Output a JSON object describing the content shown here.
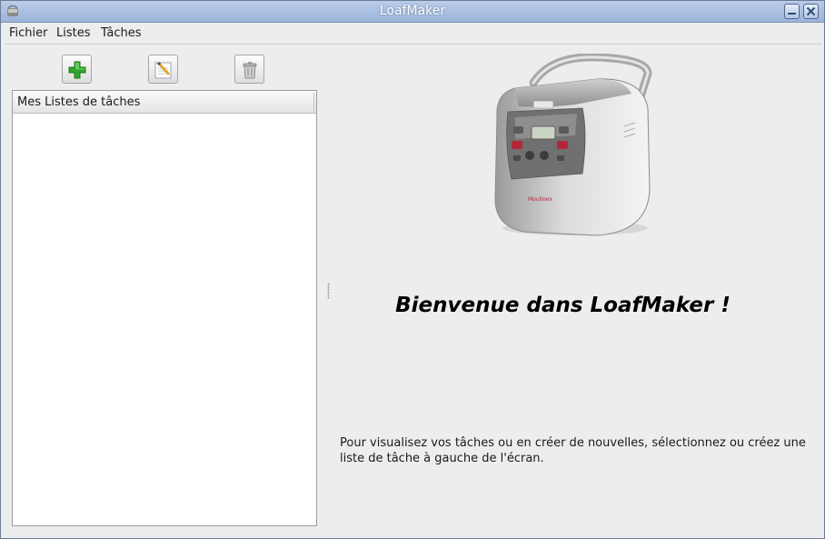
{
  "window": {
    "title": "LoafMaker"
  },
  "menu": {
    "items": [
      "Fichier",
      "Listes",
      "Tâches"
    ]
  },
  "toolbar": {
    "add_icon": "plus-icon",
    "edit_icon": "edit-note-icon",
    "delete_icon": "trash-icon"
  },
  "lists_panel": {
    "header": "Mes Listes de tâches",
    "items": []
  },
  "main": {
    "welcome": "Bienvenue dans LoafMaker !",
    "description": "Pour visualisez vos tâches ou en créer de nouvelles, sélectionnez ou créez une liste de tâche à gauche de l'écran."
  },
  "colors": {
    "titlebar": "#9bb4da",
    "plus_green": "#2fa52b",
    "panel_border": "#9c9c9c"
  }
}
